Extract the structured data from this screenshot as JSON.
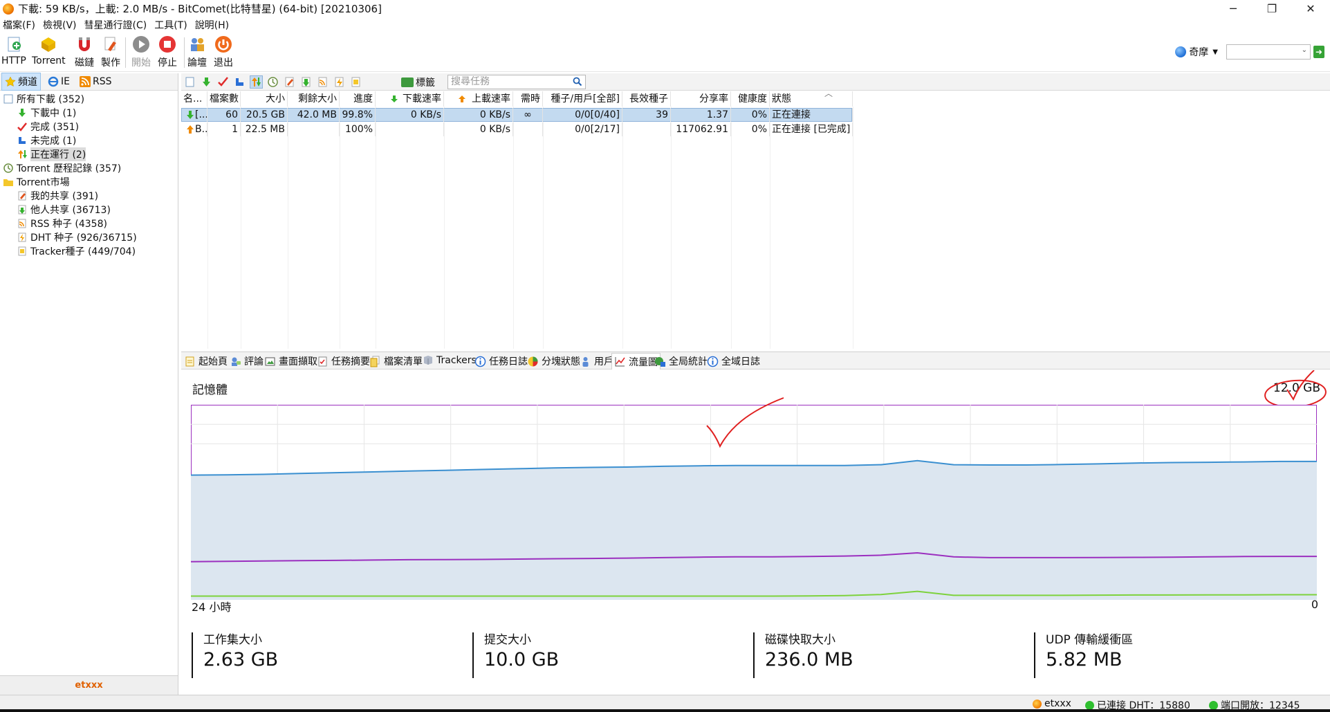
{
  "window": {
    "title": "下載: 59 KB/s，上載: 2.0 MB/s - BitComet(比特彗星) (64-bit) [20210306]",
    "minimize": "─",
    "maximize": "❐",
    "close": "✕"
  },
  "menu": [
    "檔案(F)",
    "檢視(V)",
    "彗星通行證(C)",
    "工具(T)",
    "說明(H)"
  ],
  "toolbar": {
    "http": "HTTP",
    "torrent": "Torrent",
    "magnet": "磁鏈",
    "make": "製作",
    "start": "開始",
    "stop": "停止",
    "forum": "論壇",
    "exit": "退出",
    "engine": "奇摩",
    "engine_caret": "▼",
    "search_caret": "⌄",
    "go": "➜"
  },
  "left_tabs": [
    "頻道",
    "IE",
    "RSS"
  ],
  "tree": [
    {
      "label": "所有下載 (352)",
      "icon": "all-downloads-icon"
    },
    {
      "label": "下載中 (1)",
      "icon": "downloading-icon"
    },
    {
      "label": "完成 (351)",
      "icon": "completed-check-icon"
    },
    {
      "label": "未完成 (1)",
      "icon": "incomplete-icon"
    },
    {
      "label": "正在運行 (2)",
      "icon": "running-icon"
    },
    {
      "label": "Torrent 歷程記錄 (357)",
      "icon": "history-icon"
    },
    {
      "label": "Torrent市場",
      "icon": "folder-icon"
    },
    {
      "label": "我的共享 (391)",
      "icon": "my-share-icon"
    },
    {
      "label": "他人共享 (36713)",
      "icon": "others-share-icon"
    },
    {
      "label": "RSS 种子 (4358)",
      "icon": "rss-seed-icon"
    },
    {
      "label": "DHT 种子 (926/36715)",
      "icon": "dht-seed-icon"
    },
    {
      "label": "Tracker種子 (449/704)",
      "icon": "tracker-seed-icon"
    }
  ],
  "left_footer": "etxxx",
  "task_toolbar": {
    "tag": "標籤",
    "search_placeholder": "搜尋任務"
  },
  "table": {
    "headers": [
      "名...",
      "檔案數",
      "大小",
      "剩餘大小",
      "進度",
      "下載速率",
      "上載速率",
      "需時",
      "種子/用戶[全部]",
      "長效種子",
      "分享率",
      "健康度",
      "狀態"
    ],
    "rows": [
      {
        "name": "[...",
        "files": "60",
        "size": "20.5 GB",
        "remaining": "42.0 MB",
        "progress": "99.8%",
        "down": "0 KB/s",
        "up": "0 KB/s",
        "eta": "∞",
        "seeds": "0/0[0/40]",
        "longseed": "39",
        "ratio": "1.37",
        "health": "0%",
        "status": "正在連接"
      },
      {
        "name": "B...",
        "files": "1",
        "size": "22.5 MB",
        "remaining": "",
        "progress": "100%",
        "down": "",
        "up": "0 KB/s",
        "eta": "",
        "seeds": "0/0[2/17]",
        "longseed": "",
        "ratio": "117062.91",
        "health": "0%",
        "status": "正在連接 [已完成]"
      }
    ]
  },
  "bottom_tabs": [
    "起始頁",
    "評論",
    "畫面擷取",
    "任務摘要",
    "檔案清單",
    "Trackers",
    "任務日誌",
    "分塊狀態",
    "用戶",
    "流量圖",
    "全局統計",
    "全域日誌"
  ],
  "stats": {
    "title": "記憶體",
    "max": "12.0 GB",
    "left_axis": "24 小時",
    "right_axis": "0",
    "metrics": [
      {
        "label": "工作集大小",
        "value": "2.63 GB",
        "color": "#9b2fbf"
      },
      {
        "label": "提交大小",
        "value": "10.0 GB",
        "color": "#3a8fd0"
      },
      {
        "label": "磁碟快取大小",
        "value": "236.0 MB",
        "color": "#7dd23c"
      },
      {
        "label": "UDP 傳輸緩衝區",
        "value": "5.82 MB",
        "color": "#e07b3a"
      }
    ]
  },
  "chart_data": {
    "type": "area",
    "title": "記憶體",
    "xlabel": "",
    "ylabel": "",
    "x_range_label": [
      "24 小時",
      "0"
    ],
    "ylim": [
      0,
      12.0
    ],
    "series": [
      {
        "name": "提交大小",
        "color": "#3a8fd0",
        "values": [
          7.7,
          7.72,
          7.75,
          7.8,
          7.85,
          7.9,
          7.95,
          8.0,
          8.05,
          8.1,
          8.15,
          8.18,
          8.2,
          8.25,
          8.28,
          8.3,
          8.3,
          8.3,
          8.3,
          8.35,
          8.6,
          8.35,
          8.33,
          8.33,
          8.36,
          8.4,
          8.45,
          8.48,
          8.5,
          8.52,
          8.55,
          8.55
        ]
      },
      {
        "name": "工作集大小",
        "color": "#9b2fbf",
        "values": [
          2.3,
          2.32,
          2.34,
          2.36,
          2.38,
          2.4,
          2.42,
          2.43,
          2.44,
          2.46,
          2.48,
          2.5,
          2.52,
          2.55,
          2.58,
          2.6,
          2.6,
          2.62,
          2.65,
          2.7,
          2.85,
          2.6,
          2.55,
          2.55,
          2.55,
          2.56,
          2.57,
          2.58,
          2.6,
          2.62,
          2.63,
          2.63
        ]
      },
      {
        "name": "磁碟快取大小",
        "color": "#7dd23c",
        "values": [
          0.15,
          0.15,
          0.15,
          0.15,
          0.15,
          0.15,
          0.15,
          0.15,
          0.15,
          0.15,
          0.15,
          0.15,
          0.15,
          0.15,
          0.15,
          0.15,
          0.15,
          0.16,
          0.18,
          0.25,
          0.45,
          0.2,
          0.2,
          0.2,
          0.2,
          0.21,
          0.22,
          0.22,
          0.23,
          0.23,
          0.236,
          0.236
        ]
      }
    ]
  },
  "status": {
    "user": "etxxx",
    "dht": "已連接 DHT：15880",
    "port": "端口開放：12345"
  },
  "annotations": {
    "color": "#e02020"
  }
}
